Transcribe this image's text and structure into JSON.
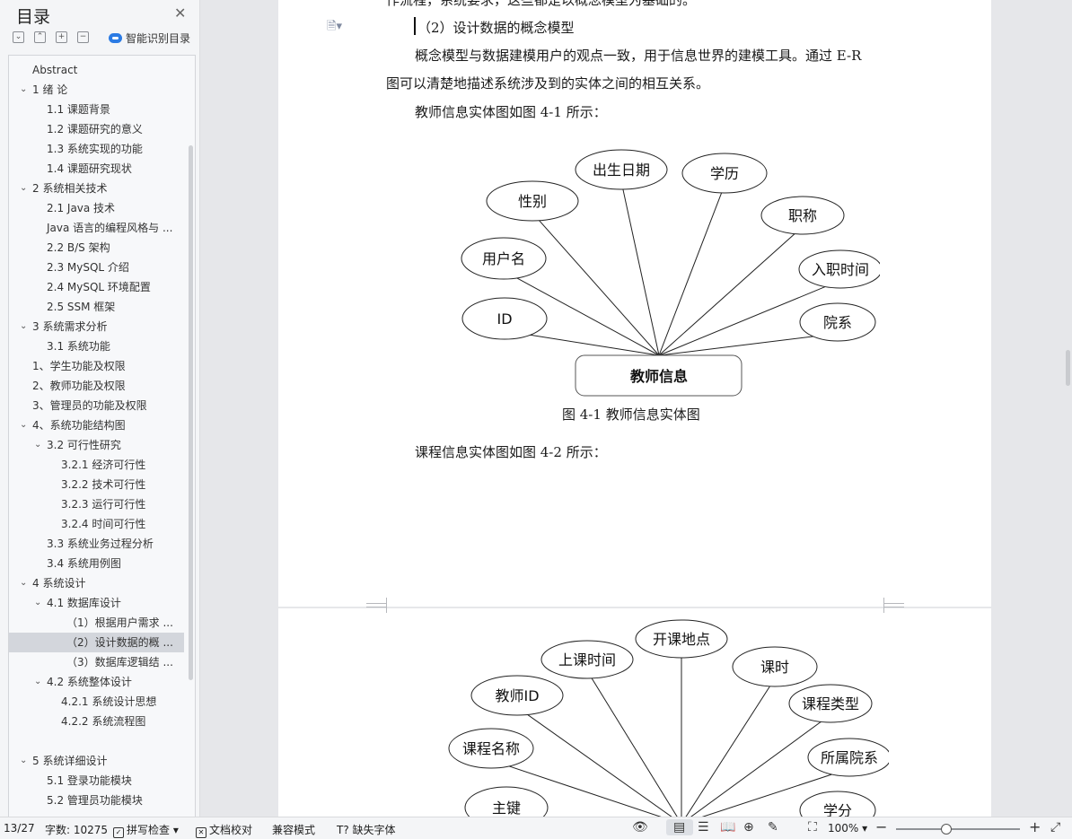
{
  "sidebar": {
    "title": "目录",
    "smart_label": "智能识别目录",
    "toolbar": [
      "⌄",
      "⌃",
      "+",
      "−"
    ],
    "items": [
      {
        "label": "Abstract",
        "level": 0,
        "chev": ""
      },
      {
        "label": "1 绪 论",
        "level": 0,
        "chev": "⌄"
      },
      {
        "label": "1.1 课题背景",
        "level": 1,
        "chev": ""
      },
      {
        "label": "1.2 课题研究的意义",
        "level": 1,
        "chev": ""
      },
      {
        "label": "1.3 系统实现的功能",
        "level": 1,
        "chev": ""
      },
      {
        "label": "1.4 课题研究现状",
        "level": 1,
        "chev": ""
      },
      {
        "label": "2 系统相关技术",
        "level": 0,
        "chev": "⌄"
      },
      {
        "label": "2.1 Java 技术",
        "level": 1,
        "chev": ""
      },
      {
        "label": "Java 语言的编程风格与 ...",
        "level": 1,
        "chev": ""
      },
      {
        "label": "2.2 B/S 架构",
        "level": 1,
        "chev": ""
      },
      {
        "label": "2.3 MySQL 介绍",
        "level": 1,
        "chev": ""
      },
      {
        "label": "2.4 MySQL 环境配置",
        "level": 1,
        "chev": ""
      },
      {
        "label": "2.5 SSM 框架",
        "level": 1,
        "chev": ""
      },
      {
        "label": "3 系统需求分析",
        "level": 0,
        "chev": "⌄"
      },
      {
        "label": "3.1 系统功能",
        "level": 1,
        "chev": ""
      },
      {
        "label": "1、学生功能及权限",
        "level": 0,
        "chev": ""
      },
      {
        "label": "2、教师功能及权限",
        "level": 0,
        "chev": ""
      },
      {
        "label": "3、管理员的功能及权限",
        "level": 0,
        "chev": ""
      },
      {
        "label": "4、系统功能结构图",
        "level": 0,
        "chev": "⌄"
      },
      {
        "label": "3.2 可行性研究",
        "level": 1,
        "chev": "⌄"
      },
      {
        "label": "3.2.1 经济可行性",
        "level": 2,
        "chev": ""
      },
      {
        "label": "3.2.2 技术可行性",
        "level": 2,
        "chev": ""
      },
      {
        "label": "3.2.3 运行可行性",
        "level": 2,
        "chev": ""
      },
      {
        "label": "3.2.4 时间可行性",
        "level": 2,
        "chev": ""
      },
      {
        "label": "3.3 系统业务过程分析",
        "level": 1,
        "chev": ""
      },
      {
        "label": "3.4 系统用例图",
        "level": 1,
        "chev": ""
      },
      {
        "label": "4 系统设计",
        "level": 0,
        "chev": "⌄"
      },
      {
        "label": "4.1 数据库设计",
        "level": 1,
        "chev": "⌄"
      },
      {
        "label": "（1）根据用户需求 ...",
        "level": 3,
        "chev": ""
      },
      {
        "label": "（2）设计数据的概 ...",
        "level": 3,
        "chev": "",
        "selected": true
      },
      {
        "label": "（3）数据库逻辑结 ...",
        "level": 3,
        "chev": ""
      },
      {
        "label": "4.2 系统整体设计",
        "level": 1,
        "chev": "⌄"
      },
      {
        "label": "4.2.1 系统设计思想",
        "level": 2,
        "chev": ""
      },
      {
        "label": "4.2.2 系统流程图",
        "level": 2,
        "chev": ""
      },
      {
        "label": "",
        "level": 0,
        "chev": ""
      },
      {
        "label": "5 系统详细设计",
        "level": 0,
        "chev": "⌄"
      },
      {
        "label": "5.1 登录功能模块",
        "level": 1,
        "chev": ""
      },
      {
        "label": "5.2 管理员功能模块",
        "level": 1,
        "chev": ""
      }
    ]
  },
  "document": {
    "top_cut_text": "作流程，系统要求，这些都是以概念模型为基础的。",
    "heading": "（2）设计数据的概念模型",
    "para1_line1": "概念模型与数据建模用户的观点一致，用于信息世界的建模工具。通过 E-R",
    "para1_line2": "图可以清楚地描述系统涉及到的实体之间的相互关系。",
    "intro1": "教师信息实体图如图 4-1 所示：",
    "caption1": "图 4-1 教师信息实体图",
    "intro2": "课程信息实体图如图 4-2 所示："
  },
  "er1": {
    "entity": "教师信息",
    "attributes": [
      "ID",
      "用户名",
      "性别",
      "出生日期",
      "学历",
      "职称",
      "入职时间",
      "院系"
    ]
  },
  "er2": {
    "attributes": [
      "主键",
      "课程名称",
      "教师ID",
      "上课时间",
      "开课地点",
      "课时",
      "课程类型",
      "所属院系",
      "学分"
    ]
  },
  "status": {
    "page": "13/27",
    "wordcount": "字数: 10275",
    "spell": "拼写检查",
    "proof": "文档校对",
    "compat": "兼容模式",
    "missing_font": "缺失字体",
    "zoom": "100%",
    "zoom_level_percent": 100
  },
  "colors": {
    "accent": "#2b7be4",
    "sidebar_bg": "#f4f5f7",
    "selected_bg": "#d3d6dc"
  }
}
